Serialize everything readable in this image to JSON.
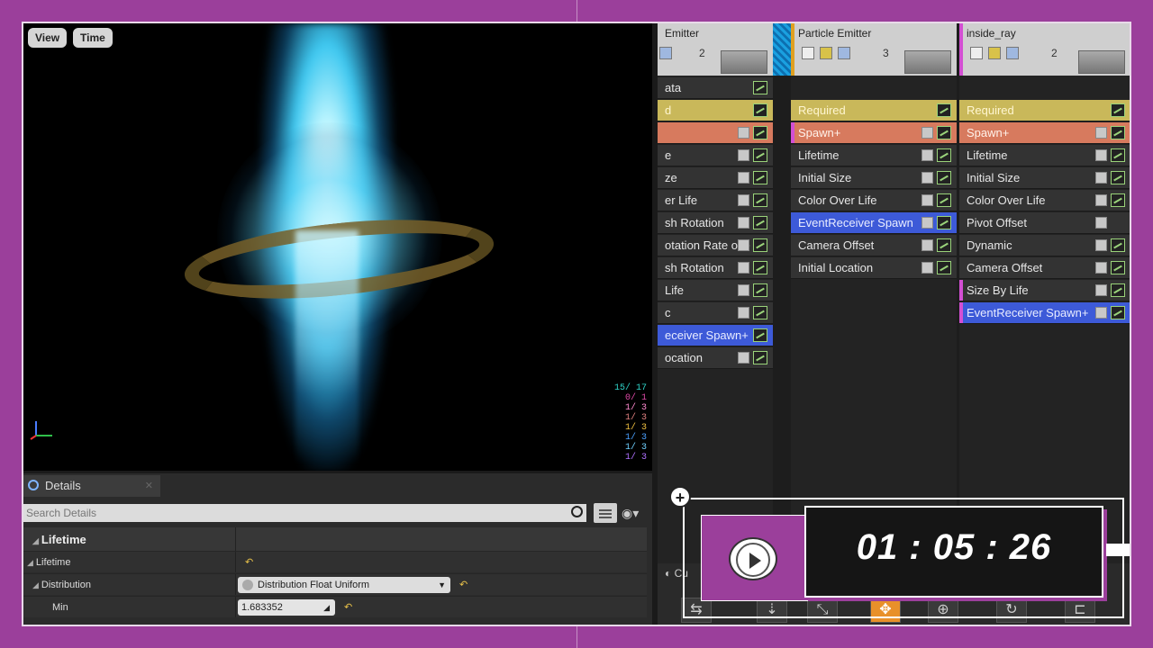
{
  "viewport": {
    "view_label": "View",
    "time_label": "Time",
    "stats": [
      "15/  17",
      "0/  1",
      "1/  3",
      "1/  3",
      "1/  3",
      "1/  3",
      "1/  3",
      "1/  3"
    ]
  },
  "details": {
    "tab_label": "Details",
    "search_placeholder": "Search Details",
    "category": "Lifetime",
    "rows": [
      {
        "label": "Lifetime"
      },
      {
        "label": "Distribution",
        "value": "Distribution Float Uniform"
      },
      {
        "label": "Min",
        "value": "1.683352"
      }
    ]
  },
  "emitters": {
    "col_a": {
      "title": "Emitter",
      "count": "2",
      "modules": [
        "ata",
        "d",
        "",
        "e",
        "ze",
        "er Life",
        "sh Rotation",
        "otation Rate ove",
        "sh Rotation",
        " Life",
        "c",
        "eceiver Spawn+",
        "ocation"
      ]
    },
    "col_b": {
      "title": "Particle Emitter",
      "count": "3",
      "modules": [
        "Required",
        "Spawn+",
        "Lifetime",
        "Initial Size",
        "Color Over Life",
        "EventReceiver Spawn",
        "Camera Offset",
        "Initial Location"
      ]
    },
    "col_c": {
      "title": "inside_ray",
      "count": "2",
      "modules": [
        "Required",
        "Spawn+",
        "Lifetime",
        "Initial Size",
        "Color Over Life",
        "Pivot Offset",
        "Dynamic",
        "Camera Offset",
        "Size By Life",
        "EventReceiver Spawn+"
      ]
    }
  },
  "curve_tab_label": "Cu",
  "timer": {
    "display": "01 : 05 : 26",
    "add_label": "+"
  },
  "colors": {
    "background": "#9b3f9b",
    "required": "#c9b85a",
    "spawn": "#d77a5e",
    "event": "#3d5ad8"
  }
}
